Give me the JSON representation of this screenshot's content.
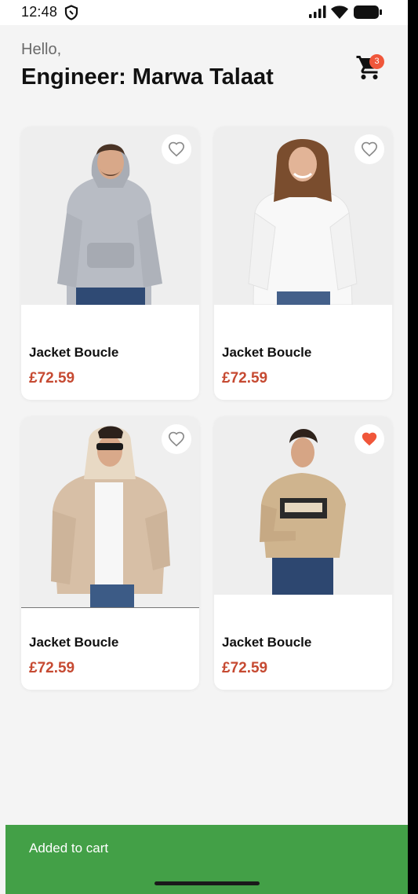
{
  "status_bar": {
    "time": "12:48",
    "icons": [
      "shield-icon",
      "signal-icon",
      "wifi-icon",
      "battery-icon"
    ]
  },
  "header": {
    "greeting": "Hello,",
    "user_name": "Engineer: Marwa Talaat",
    "cart_icon": "cart-icon",
    "cart_count": "3"
  },
  "products": [
    {
      "title": "Jacket Boucle",
      "price": "£72.59",
      "favorite": false,
      "image": "man-grey-hoodie"
    },
    {
      "title": "Jacket Boucle",
      "price": "£72.59",
      "favorite": false,
      "image": "woman-white-sweatshirt"
    },
    {
      "title": "Jacket Boucle",
      "price": "£72.59",
      "favorite": false,
      "image": "man-beige-puffer-jacket"
    },
    {
      "title": "Jacket Boucle",
      "price": "£72.59",
      "favorite": true,
      "image": "man-beige-positive-hoodie"
    }
  ],
  "snackbar": {
    "message": "Added to cart"
  },
  "colors": {
    "background": "#f4f4f4",
    "price": "#c64a32",
    "favorite_active": "#f0563a",
    "favorite_inactive": "#8a8a8a",
    "badge": "#f0563a",
    "snackbar": "#43a047"
  }
}
